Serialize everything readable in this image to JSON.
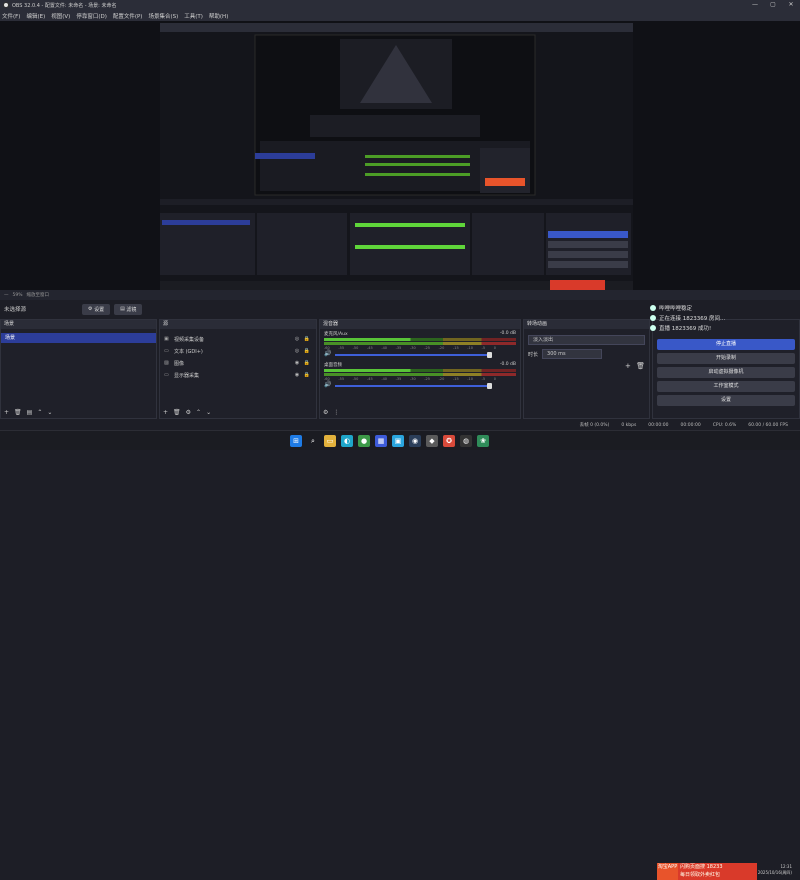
{
  "window": {
    "title": "OBS 32.0.4 - 配置文件: 未命名 - 场景: 未命名",
    "min": "—",
    "max": "▢",
    "close": "✕"
  },
  "menu": [
    "文件(F)",
    "编辑(E)",
    "视图(V)",
    "停靠窗口(D)",
    "配置文件(P)",
    "场景集合(S)",
    "工具(T)",
    "帮助(H)"
  ],
  "transition_row": {
    "left": "—",
    "zoom": "59%",
    "mode": "缩放至窗口"
  },
  "scene_bar": {
    "label": "未选择源",
    "settings": "设置",
    "filters": "滤镜"
  },
  "scenes": {
    "header": "场景",
    "items": [
      "场景"
    ]
  },
  "sources": {
    "header": "源",
    "items": [
      {
        "icon": "video-capture-icon",
        "name": "视频采集设备"
      },
      {
        "icon": "text-icon",
        "name": "文本 (GDI+)"
      },
      {
        "icon": "image-icon",
        "name": "图像"
      },
      {
        "icon": "display-capture-icon",
        "name": "显示器采集"
      }
    ]
  },
  "mixer": {
    "header": "混音器",
    "channels": [
      {
        "name": "麦克风/Aux",
        "db": "-0.0 dB",
        "ticks": [
          "-60",
          "-55",
          "-50",
          "-45",
          "-40",
          "-35",
          "-30",
          "-25",
          "-20",
          "-15",
          "-10",
          "-5",
          "0"
        ]
      },
      {
        "name": "桌面音频",
        "db": "-0.0 dB",
        "ticks": [
          "-60",
          "-55",
          "-50",
          "-45",
          "-40",
          "-35",
          "-30",
          "-25",
          "-20",
          "-15",
          "-10",
          "-5",
          "0"
        ]
      }
    ]
  },
  "transitions": {
    "header": "转场动画",
    "selected": "淡入淡出",
    "duration_label": "时长",
    "duration": "300 ms"
  },
  "controls": {
    "notifications": [
      "哔哩哔哩稳定",
      "正在连接 1823369 房间...",
      "直播 1823369 成功!"
    ],
    "stop_stream": "停止直播",
    "start_record": "开始录制",
    "virtual_cam": "启动虚拟摄像机",
    "studio_mode": "工作室模式",
    "settings": "设置"
  },
  "status": {
    "dropped": "丢帧 0 (0.0%)",
    "kbps": "0 kbps",
    "time1": "00:00:00",
    "time2": "00:00:00",
    "cpu": "CPU: 0.6%",
    "fps": "60.00 / 60.00 FPS"
  },
  "taskbar": {
    "ad_brand": "淘宝APP",
    "ad_line1": "闪购页面搜 18233",
    "ad_line2": "每日领取外卖红包",
    "clock_time": "12:31",
    "clock_date": "2025/10/16(周四)"
  },
  "colors": {
    "accent": "#3958c8",
    "bg": "#1d1e26",
    "panel": "#1f2029"
  }
}
